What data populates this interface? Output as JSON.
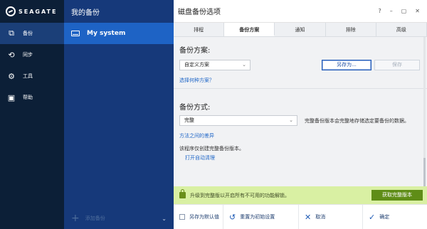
{
  "brand": {
    "name": "SEAGATE"
  },
  "nav": {
    "items": [
      {
        "label": "备份",
        "icon": "copy-icon",
        "glyph": "⧉",
        "active": true
      },
      {
        "label": "同步",
        "icon": "sync-icon",
        "glyph": "⟲",
        "active": false
      },
      {
        "label": "工具",
        "icon": "tools-icon",
        "glyph": "⚙",
        "active": false
      },
      {
        "label": "帮助",
        "icon": "book-icon",
        "glyph": "▣",
        "active": false
      }
    ]
  },
  "backups": {
    "title": "我的备份",
    "item": "My system",
    "add_label": "添加备份"
  },
  "window": {
    "title": "磁盘备份选项",
    "controls": {
      "help": "?",
      "minimize": "–",
      "maximize": "▢",
      "close": "✕"
    }
  },
  "tabs": [
    {
      "label": "排程",
      "active": false
    },
    {
      "label": "备份方案",
      "active": true
    },
    {
      "label": "通知",
      "active": false
    },
    {
      "label": "排除",
      "active": false
    },
    {
      "label": "高级",
      "active": false
    }
  ],
  "scheme": {
    "heading": "备份方案:",
    "select_value": "自定义方案",
    "save_as_label": "另存为...",
    "save_label": "保存",
    "link": "选择何种方案？"
  },
  "method": {
    "heading": "备份方式:",
    "select_value": "完整",
    "description": "完整备份版本会完整地存储选定要备份的数据。",
    "link": "方法之间的差异",
    "note": "该程序仅创建完整备份版本。",
    "auto_clean_link": "打开自动清理"
  },
  "promo": {
    "text": "升级到完整版以开启所有不可用的功能解锁。",
    "button": "获取完整版本"
  },
  "footer": {
    "save_default": "另存为默认值",
    "reset": "重置为初始设置",
    "cancel": "取消",
    "ok": "确定"
  }
}
